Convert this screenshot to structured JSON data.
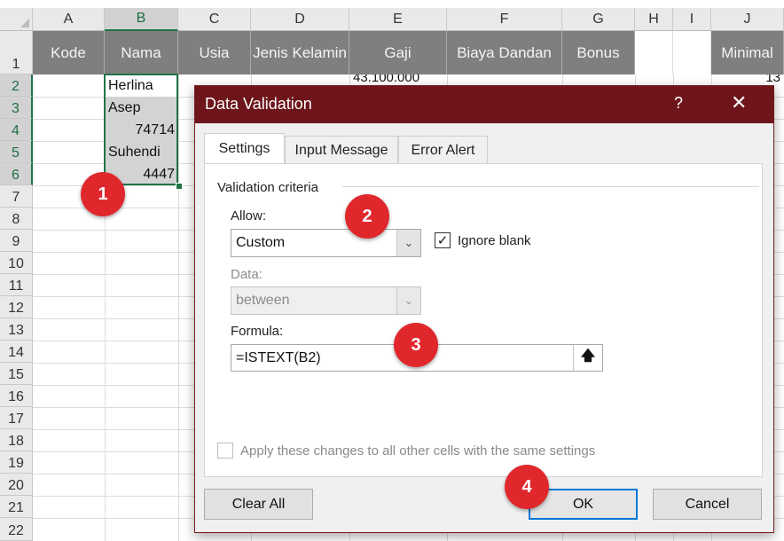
{
  "sheet": {
    "columns": [
      "A",
      "B",
      "C",
      "D",
      "E",
      "F",
      "G",
      "H",
      "I",
      "J"
    ],
    "rows": [
      "1",
      "2",
      "3",
      "4",
      "5",
      "6",
      "7",
      "8",
      "9",
      "10",
      "11",
      "12",
      "13",
      "14",
      "15",
      "16",
      "17",
      "18",
      "19",
      "20",
      "21",
      "22"
    ],
    "headers": [
      "Kode",
      "Nama",
      "Usia",
      "Jenis Kelamin",
      "Gaji",
      "Biaya Dandan",
      "Bonus",
      "",
      "",
      "Minimal"
    ],
    "nama_values": [
      "Herlina",
      "Asep",
      "74714",
      "Suhendi",
      "4447"
    ],
    "partial_e2": "43.100.000",
    "partial_j2": "13",
    "selected_column": "B",
    "header_fill": "#7f7f7f"
  },
  "dialog": {
    "title": "Data Validation",
    "help": "?",
    "close": "✕",
    "tabs": [
      "Settings",
      "Input Message",
      "Error Alert"
    ],
    "section_label": "Validation criteria",
    "allow_label": "Allow:",
    "allow_value": "Custom",
    "ignore_blank_label": "Ignore blank",
    "ignore_blank_checked": true,
    "data_label": "Data:",
    "data_value": "between",
    "formula_label": "Formula:",
    "formula_value": "=ISTEXT(B2)",
    "apply_label": "Apply these changes to all other cells with the same settings",
    "clear_all": "Clear All",
    "ok": "OK",
    "cancel": "Cancel",
    "title_color": "#6d151a"
  },
  "annotations": [
    "1",
    "2",
    "3",
    "4"
  ]
}
